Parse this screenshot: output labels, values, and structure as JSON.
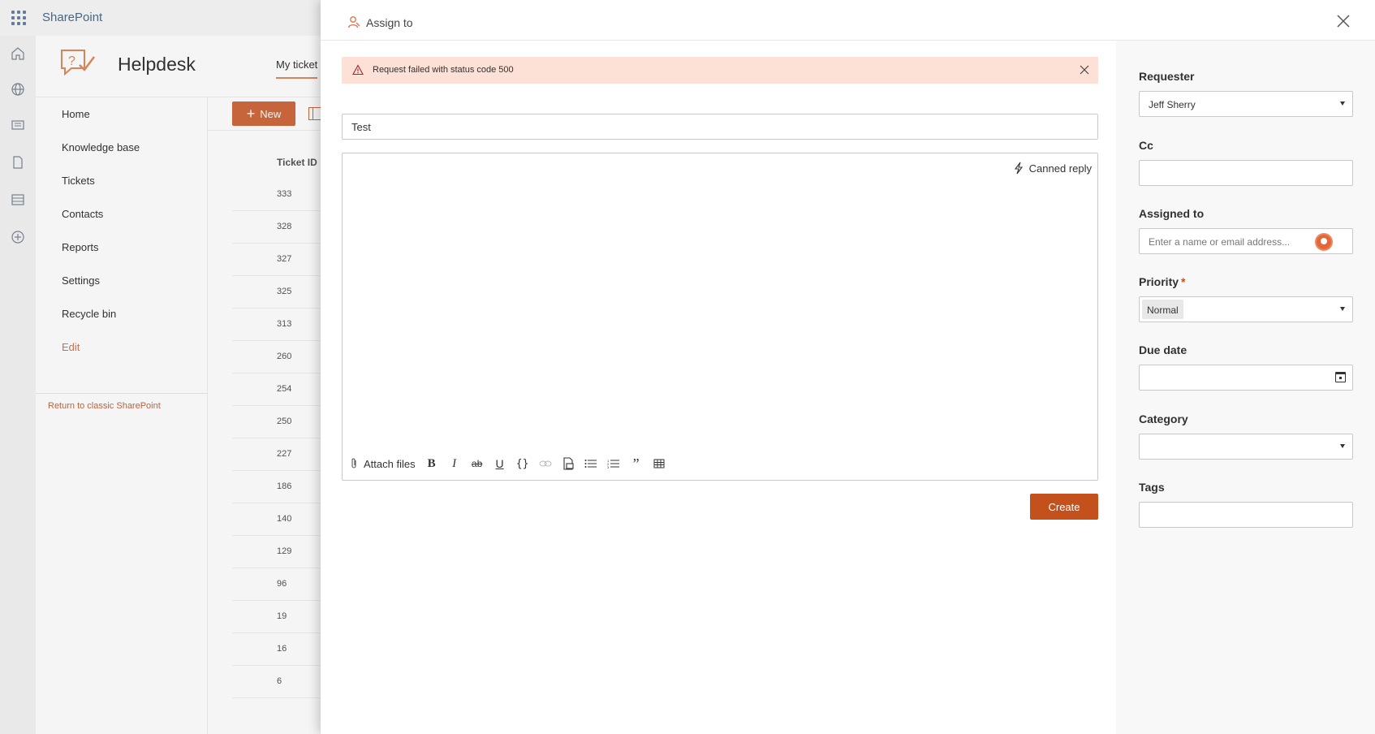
{
  "suite": {
    "brand": "SharePoint"
  },
  "site": {
    "title": "Helpdesk",
    "tab": "My ticket"
  },
  "leftnav": {
    "items": [
      "Home",
      "Knowledge base",
      "Tickets",
      "Contacts",
      "Reports",
      "Settings",
      "Recycle bin"
    ],
    "edit": "Edit",
    "return": "Return to classic SharePoint"
  },
  "commandbar": {
    "new_label": "New"
  },
  "list": {
    "column": "Ticket ID",
    "rows": [
      "333",
      "328",
      "327",
      "325",
      "313",
      "260",
      "254",
      "250",
      "227",
      "186",
      "140",
      "129",
      "96",
      "19",
      "16",
      "6"
    ]
  },
  "panel": {
    "header": "Assign to",
    "error": "Request failed with status code 500",
    "subject_value": "Test",
    "canned_reply": "Canned reply",
    "attach_files": "Attach files",
    "create_label": "Create"
  },
  "form": {
    "requester_label": "Requester",
    "requester_value": "Jeff Sherry",
    "cc_label": "Cc",
    "assigned_label": "Assigned to",
    "assigned_placeholder": "Enter a name or email address...",
    "priority_label": "Priority",
    "priority_required": "*",
    "priority_value": "Normal",
    "due_label": "Due date",
    "category_label": "Category",
    "tags_label": "Tags"
  },
  "colors": {
    "accent": "#c4501b",
    "error_bg": "#fde0d6",
    "nav_accent": "#d9744a"
  }
}
